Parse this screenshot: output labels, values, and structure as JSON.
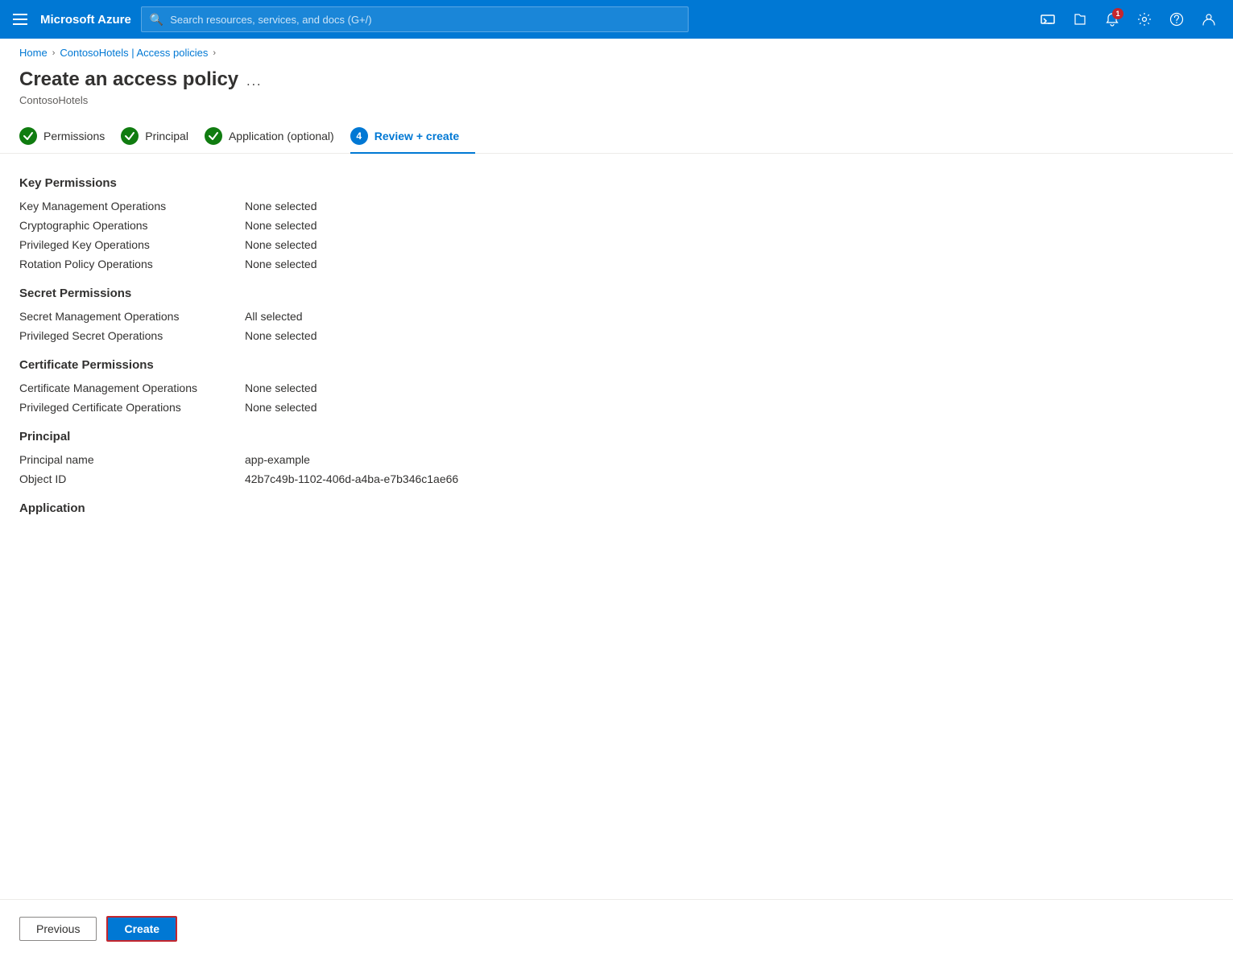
{
  "topbar": {
    "brand": "Microsoft Azure",
    "search_placeholder": "Search resources, services, and docs (G+/)",
    "notification_count": "1"
  },
  "breadcrumb": {
    "home": "Home",
    "parent": "ContosoHotels | Access policies"
  },
  "page": {
    "title": "Create an access policy",
    "subtitle": "ContosoHotels",
    "more_btn": "..."
  },
  "steps": [
    {
      "id": "permissions",
      "label": "Permissions",
      "state": "done",
      "number": ""
    },
    {
      "id": "principal",
      "label": "Principal",
      "state": "done",
      "number": ""
    },
    {
      "id": "application",
      "label": "Application (optional)",
      "state": "done",
      "number": ""
    },
    {
      "id": "review",
      "label": "Review + create",
      "state": "active",
      "number": "4"
    }
  ],
  "sections": {
    "key_permissions": {
      "title": "Key Permissions",
      "rows": [
        {
          "label": "Key Management Operations",
          "value": "None selected"
        },
        {
          "label": "Cryptographic Operations",
          "value": "None selected"
        },
        {
          "label": "Privileged Key Operations",
          "value": "None selected"
        },
        {
          "label": "Rotation Policy Operations",
          "value": "None selected"
        }
      ]
    },
    "secret_permissions": {
      "title": "Secret Permissions",
      "rows": [
        {
          "label": "Secret Management Operations",
          "value": "All selected"
        },
        {
          "label": "Privileged Secret Operations",
          "value": "None selected"
        }
      ]
    },
    "certificate_permissions": {
      "title": "Certificate Permissions",
      "rows": [
        {
          "label": "Certificate Management Operations",
          "value": "None selected"
        },
        {
          "label": "Privileged Certificate Operations",
          "value": "None selected"
        }
      ]
    },
    "principal": {
      "title": "Principal",
      "rows": [
        {
          "label": "Principal name",
          "value": "app-example"
        },
        {
          "label": "Object ID",
          "value": "42b7c49b-1102-406d-a4ba-e7b346c1ae66"
        }
      ]
    },
    "application": {
      "title": "Application",
      "rows": []
    }
  },
  "buttons": {
    "previous": "Previous",
    "create": "Create"
  }
}
